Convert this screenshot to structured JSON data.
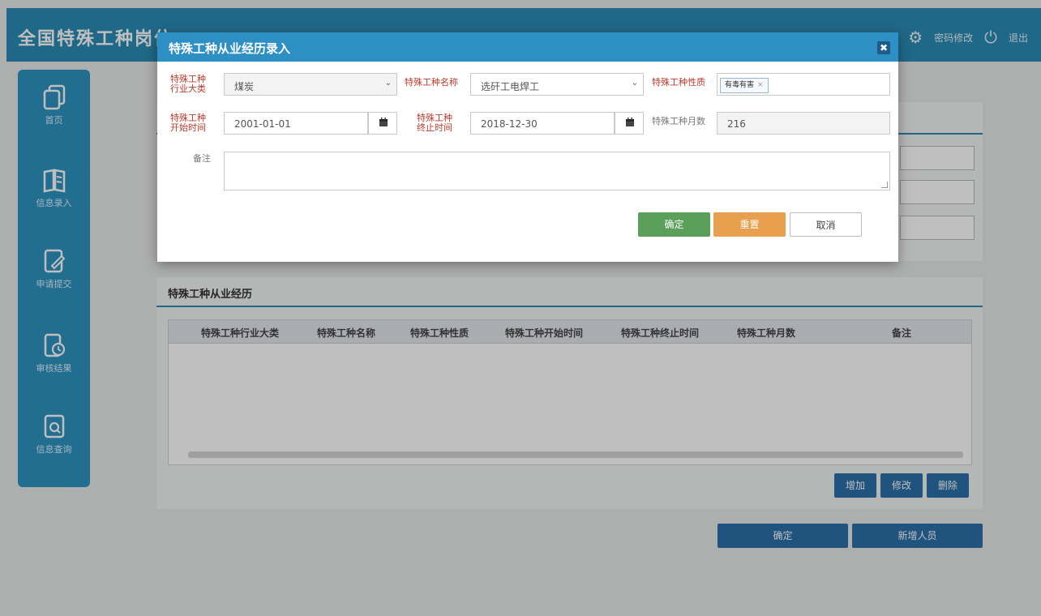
{
  "app": {
    "title": "全国特殊工种岗位",
    "user_actions": {
      "password_label": "密码修改",
      "logout_label": "退出"
    }
  },
  "sidebar": {
    "items": [
      {
        "label": "首页",
        "icon": "copy-icon"
      },
      {
        "label": "信息录入",
        "icon": "book-icon"
      },
      {
        "label": "申请提交",
        "icon": "edit-icon"
      },
      {
        "label": "审核结果",
        "icon": "clock-doc-icon"
      },
      {
        "label": "信息查询",
        "icon": "search-doc-icon"
      }
    ]
  },
  "history_section": {
    "title": "特殊工种从业经历",
    "columns": [
      "特殊工种行业大类",
      "特殊工种名称",
      "特殊工种性质",
      "特殊工种开始时间",
      "特殊工种终止时间",
      "特殊工种月数",
      "备注"
    ],
    "rows": [],
    "buttons": {
      "add": "增加",
      "edit": "修改",
      "delete": "删除"
    }
  },
  "footer_buttons": {
    "confirm": "确定",
    "add_person": "新增人员"
  },
  "modal": {
    "title": "特殊工种从业经历录入",
    "close_symbol": "✖",
    "fields": {
      "industry": {
        "label_line1": "特殊工种",
        "label_line2": "行业大类",
        "value": "煤炭"
      },
      "job_name": {
        "label": "特殊工种名称",
        "value": "选矸工电焊工"
      },
      "nature": {
        "label": "特殊工种性质",
        "tag": "有毒有害",
        "tag_remove": "×"
      },
      "start": {
        "label_line1": "特殊工种",
        "label_line2": "开始时间",
        "value": "2001-01-01"
      },
      "end": {
        "label_line1": "特殊工种",
        "label_line2": "终止时间",
        "value": "2018-12-30"
      },
      "months": {
        "label": "特殊工种月数",
        "value": "216"
      },
      "remark": {
        "label": "备注",
        "value": ""
      }
    },
    "buttons": {
      "ok": "确定",
      "reset": "重置",
      "cancel": "取消"
    }
  },
  "colors": {
    "primary": "#2b8bb5",
    "modal_header": "#2d8fc4",
    "required_label": "#c0392b",
    "ok_button": "#5aa05a",
    "reset_button": "#e8a04e",
    "dark_button": "#2b6fa8"
  }
}
